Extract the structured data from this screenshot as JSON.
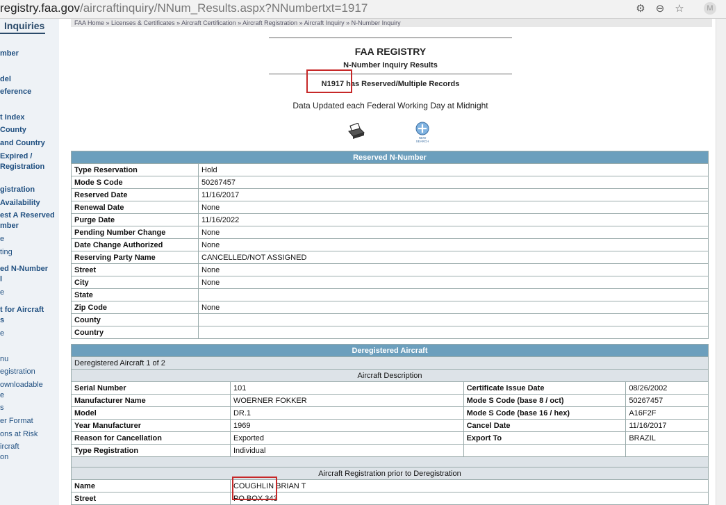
{
  "browser": {
    "url_host": "registry.faa.gov",
    "url_path": "/aircraftinquiry/NNum_Results.aspx?NNumbertxt=1917"
  },
  "sidebar": {
    "title": "Inquiries",
    "items": [
      {
        "label": "mber",
        "bold": true
      },
      {
        "label": "del",
        "bold": true
      },
      {
        "label": "eference",
        "bold": true
      },
      {
        "label": "t Index",
        "bold": true
      },
      {
        "label": "County",
        "bold": true
      },
      {
        "label": "and Country",
        "bold": true
      },
      {
        "label": "Expired /",
        "bold": true
      },
      {
        "label": "Registration",
        "bold": true
      },
      {
        "label": "gistration",
        "bold": true
      },
      {
        "label": " Availability",
        "bold": true
      },
      {
        "label": "est A Reserved",
        "bold": true
      },
      {
        "label": "mber",
        "bold": true
      },
      {
        "label": "e",
        "bold": false
      },
      {
        "label": "ting",
        "bold": false
      },
      {
        "label": "ed N-Number",
        "bold": true
      },
      {
        "label": "l",
        "bold": true
      },
      {
        "label": "e",
        "bold": false
      },
      {
        "label": "t for Aircraft",
        "bold": true
      },
      {
        "label": "s",
        "bold": true
      },
      {
        "label": "e",
        "bold": false
      },
      {
        "label": "nu",
        "bold": false
      },
      {
        "label": "egistration",
        "bold": false
      },
      {
        "label": "ownloadable",
        "bold": false
      },
      {
        "label": "e",
        "bold": false
      },
      {
        "label": "s",
        "bold": false
      },
      {
        "label": "er Format",
        "bold": false
      },
      {
        "label": "ons at Risk",
        "bold": false
      },
      {
        "label": "ircraft",
        "bold": false
      },
      {
        "label": "on",
        "bold": false
      }
    ]
  },
  "breadcrumb": "FAA Home » Licenses & Certificates » Aircraft Certification » Aircraft Registration » Aircraft Inquiry » N-Number Inquiry",
  "header": {
    "title": "FAA REGISTRY",
    "subtitle": "N-Number Inquiry Results",
    "status": "N1917 has Reserved/Multiple Records",
    "updated": "Data Updated each Federal Working Day at Midnight"
  },
  "icons": {
    "print": "print-icon",
    "new_search": "new-search-icon",
    "new_search_label": "NEW SEARCH"
  },
  "reserved": {
    "heading": "Reserved N-Number",
    "rows": [
      {
        "label": "Type Reservation",
        "value": "Hold"
      },
      {
        "label": "Mode S Code",
        "value": "50267457"
      },
      {
        "label": "Reserved Date",
        "value": "11/16/2017"
      },
      {
        "label": "Renewal Date",
        "value": "None"
      },
      {
        "label": "Purge Date",
        "value": "11/16/2022"
      },
      {
        "label": "Pending Number Change",
        "value": "None"
      },
      {
        "label": "Date Change Authorized",
        "value": "None"
      },
      {
        "label": "Reserving Party Name",
        "value": "CANCELLED/NOT ASSIGNED"
      },
      {
        "label": "Street",
        "value": "None"
      },
      {
        "label": "City",
        "value": "None"
      },
      {
        "label": "State",
        "value": ""
      },
      {
        "label": "Zip Code",
        "value": "None"
      },
      {
        "label": "County",
        "value": ""
      },
      {
        "label": "Country",
        "value": ""
      }
    ]
  },
  "deregistered": {
    "heading": "Deregistered Aircraft",
    "count_label": "Deregistered Aircraft 1 of 2",
    "description_heading": "Aircraft Description",
    "rows": [
      {
        "l1": "Serial Number",
        "v1": "101",
        "l2": "Certificate Issue Date",
        "v2": "08/26/2002"
      },
      {
        "l1": "Manufacturer Name",
        "v1": "WOERNER FOKKER",
        "l2": "Mode S Code (base 8 / oct)",
        "v2": "50267457"
      },
      {
        "l1": "Model",
        "v1": "DR.1",
        "l2": "Mode S Code (base 16 / hex)",
        "v2": "A16F2F"
      },
      {
        "l1": "Year Manufacturer",
        "v1": "1969",
        "l2": "Cancel Date",
        "v2": "11/16/2017"
      },
      {
        "l1": "Reason for Cancellation",
        "v1": "Exported",
        "l2": "Export To",
        "v2": "BRAZIL"
      },
      {
        "l1": "Type Registration",
        "v1": "Individual",
        "l2": "",
        "v2": ""
      }
    ],
    "prior_heading": "Aircraft Registration prior to Deregistration",
    "prior_rows": [
      {
        "label": "Name",
        "value": "COUGHLIN BRIAN T"
      },
      {
        "label": "Street",
        "value": "PO BOX 343"
      }
    ]
  }
}
